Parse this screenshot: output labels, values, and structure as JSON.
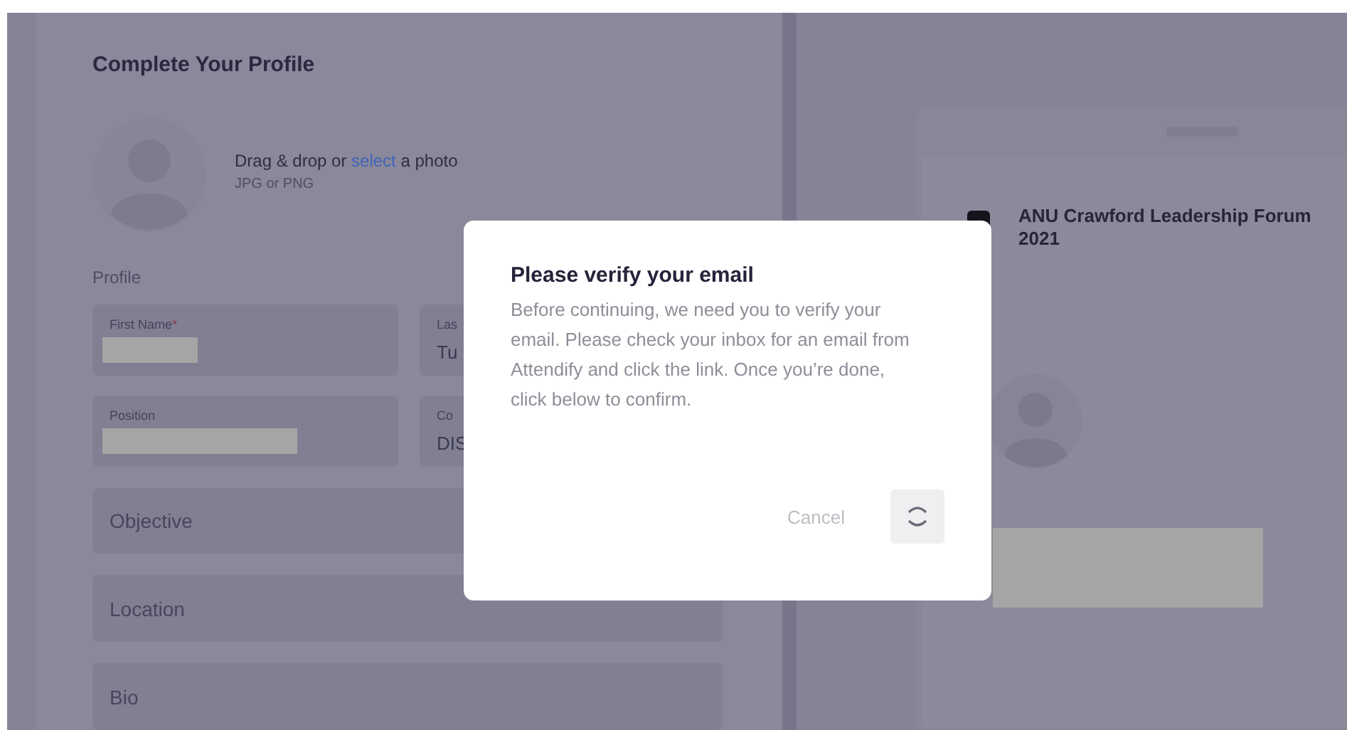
{
  "profile": {
    "title": "Complete Your Profile",
    "upload": {
      "text_before": "Drag & drop or",
      "link": "select",
      "text_after": "a photo",
      "hint": "JPG or PNG"
    },
    "section_label": "Profile",
    "field_rows": [
      [
        {
          "label": "First Name",
          "required_mark": "*",
          "redacted": true
        },
        {
          "label": "Las",
          "value": "Tu",
          "redacted": false
        }
      ],
      [
        {
          "label": "Position",
          "redacted": true
        },
        {
          "label": "Co",
          "value": "DIS",
          "redacted": false
        }
      ]
    ],
    "wide_fields": [
      {
        "placeholder": "Objective"
      },
      {
        "placeholder": "Location"
      },
      {
        "placeholder": "Bio"
      }
    ]
  },
  "preview": {
    "event_title": "ANU Crawford Leadership Forum 2021",
    "name_redacted": true
  },
  "dialog": {
    "title": "Please verify your email",
    "message": "Before continuing, we need you to verify your email. Please check your inbox for an email from Attendify and click the link. Once you’re done, click below to confirm.",
    "buttons": [
      {
        "kind": "text",
        "label": "Cancel"
      },
      {
        "kind": "spinner"
      }
    ]
  }
}
